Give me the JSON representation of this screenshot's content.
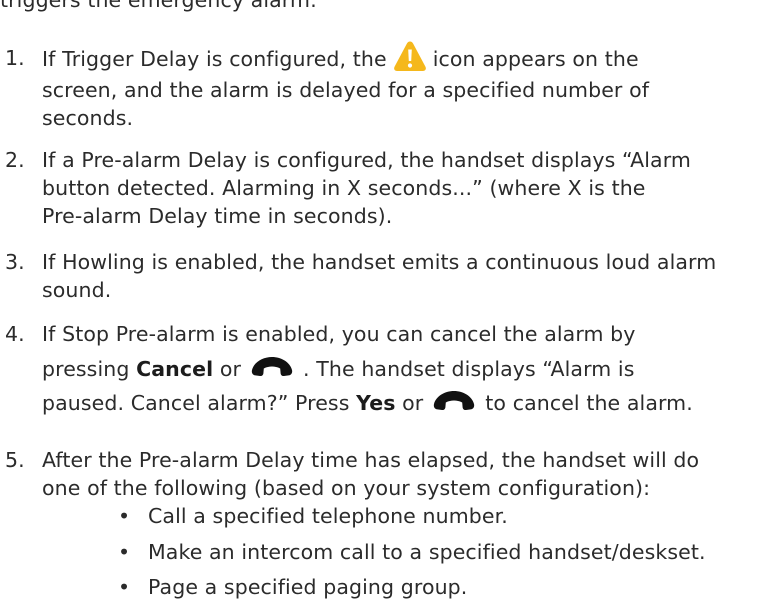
{
  "intro": "triggers the emergency alarm:",
  "steps": [
    {
      "number": "1.",
      "line1_before": "If Trigger Delay is configured, the",
      "line1_after": "icon appears on the",
      "line2": "screen, and the alarm is delayed for a specified number of",
      "line3": "seconds.",
      "icon": "warning-icon"
    },
    {
      "number": "2.",
      "line1": "If a Pre-alarm Delay is configured, the handset displays “Alarm",
      "line2": "button detected. Alarming in X seconds...” (where X is the",
      "line3": "Pre-alarm Delay time in seconds)."
    },
    {
      "number": "3.",
      "line1": "If Howling is enabled, the handset emits a continuous loud alarm",
      "line2": "sound."
    },
    {
      "number": "4.",
      "line1": "If Stop Pre-alarm is enabled, you can cancel the alarm by",
      "line2_before": "pressing",
      "cancel_label": "Cancel",
      "line2_or": "or",
      "line2_after": ". The handset displays “Alarm is",
      "line3_before": "paused. Cancel alarm?” Press",
      "yes_label": "Yes",
      "line3_or": "or",
      "line3_after": "to cancel the alarm.",
      "icon": "end-call-handset-icon"
    },
    {
      "number": "5.",
      "line1": "After the Pre-alarm Delay time has elapsed, the handset will do",
      "line2": "one of the following (based on your system configuration):",
      "bullets": [
        "Call a specified telephone number.",
        "Make an intercom call to a specified handset/deskset.",
        "Page a specified paging group."
      ]
    }
  ],
  "colors": {
    "text": "#2b2b2b",
    "warning_fill": "#f5b81c",
    "handset": "#111111"
  }
}
